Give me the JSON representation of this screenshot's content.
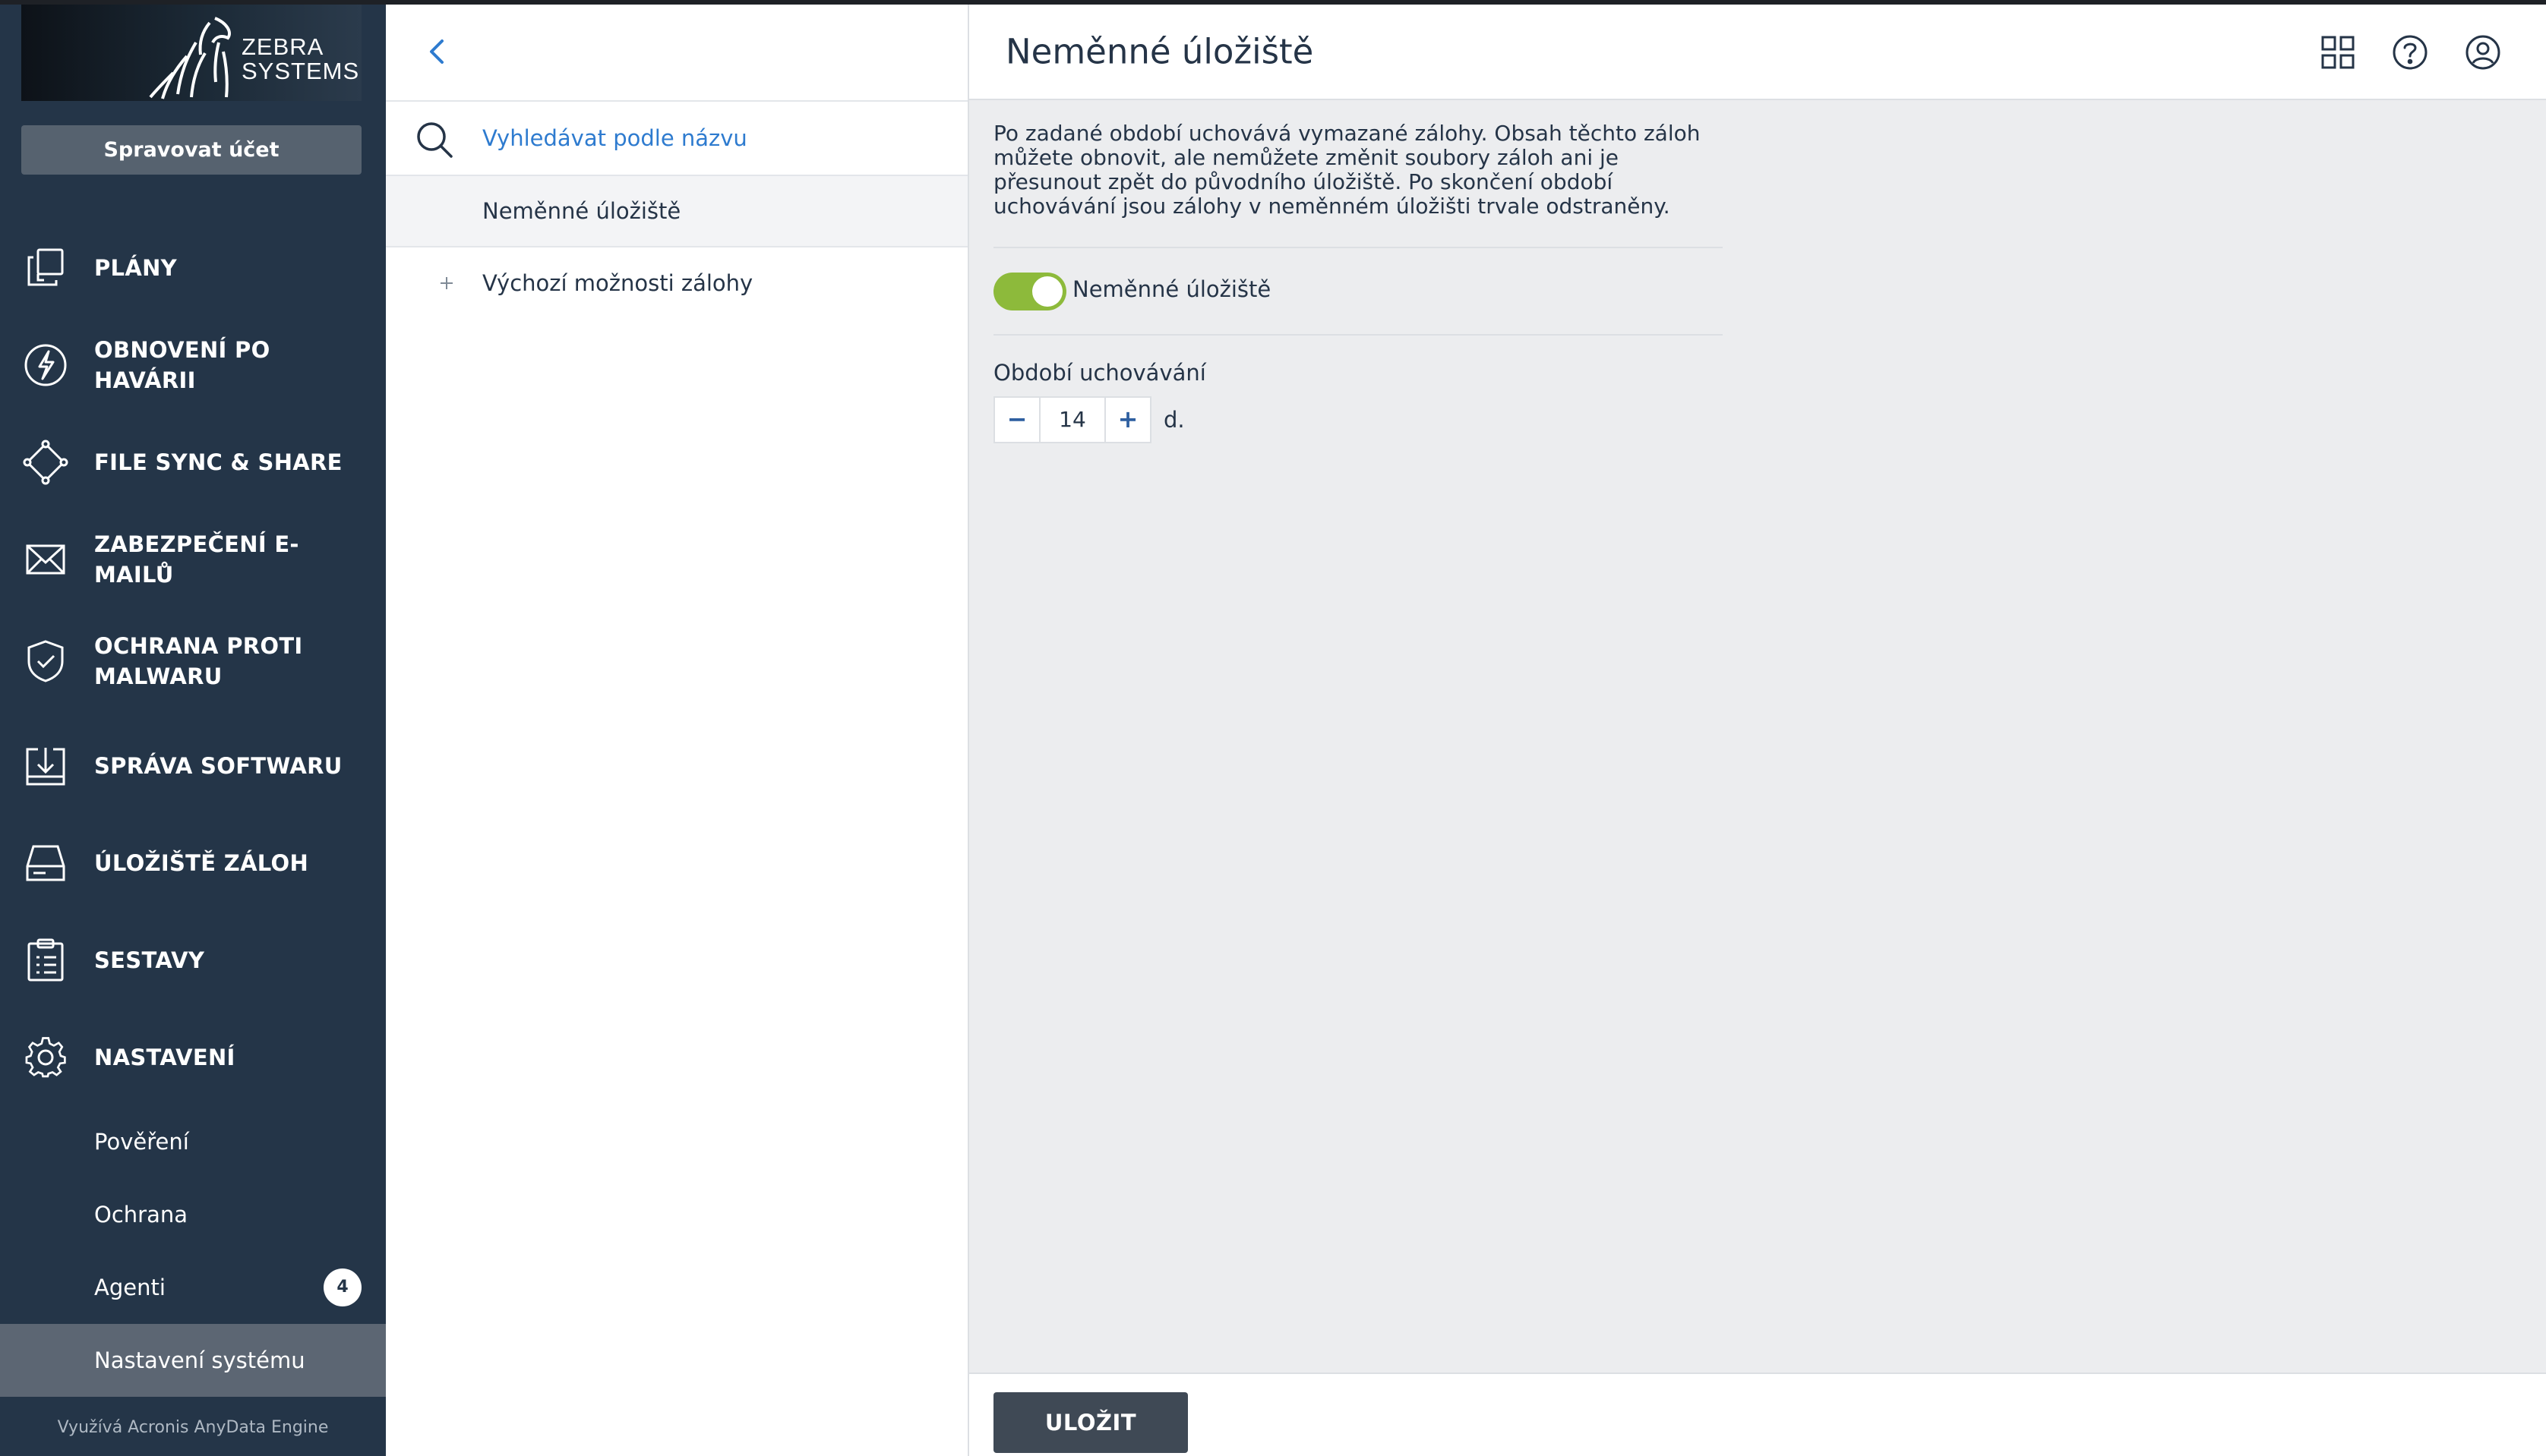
{
  "sidebar": {
    "logo_text_line1": "ZEBRA",
    "logo_text_line2": "SYSTEMS",
    "manage_account": "Spravovat účet",
    "items": [
      {
        "label": "PLÁNY",
        "icon": "plans-icon"
      },
      {
        "label": "OBNOVENÍ PO HAVÁRII",
        "icon": "lightning-icon"
      },
      {
        "label": "FILE SYNC & SHARE",
        "icon": "sync-share-icon"
      },
      {
        "label": "ZABEZPEČENÍ E-MAILŮ",
        "icon": "envelope-icon"
      },
      {
        "label": "OCHRANA PROTI MALWARU",
        "icon": "shield-check-icon"
      },
      {
        "label": "SPRÁVA SOFTWARU",
        "icon": "software-download-icon"
      },
      {
        "label": "ÚLOŽIŠTĚ ZÁLOH",
        "icon": "storage-drive-icon"
      },
      {
        "label": "SESTAVY",
        "icon": "clipboard-report-icon"
      },
      {
        "label": "NASTAVENÍ",
        "icon": "gear-icon"
      }
    ],
    "subitems": [
      {
        "label": "Pověření"
      },
      {
        "label": "Ochrana"
      },
      {
        "label": "Agenti",
        "badge": "4"
      },
      {
        "label": "Nastavení systému"
      }
    ],
    "footer": "Využívá Acronis AnyData Engine"
  },
  "middle": {
    "search_placeholder": "Vyhledávat podle názvu",
    "items": [
      {
        "label": "Neměnné úložiště"
      },
      {
        "label": "Výchozí možnosti zálohy"
      }
    ]
  },
  "main": {
    "title": "Neměnné úložiště",
    "description": "Po zadané období uchovává vymazané zálohy. Obsah těchto záloh můžete obnovit, ale nemůžete změnit soubory záloh ani je přesunout zpět do původního úložiště. Po skončení období uchovávání jsou zálohy v neměnném úložišti trvale odstraněny.",
    "toggle_label": "Neměnné úložiště",
    "toggle_on": true,
    "retention_label": "Období uchovávání",
    "retention_value": "14",
    "retention_unit": "d.",
    "minus": "−",
    "plus": "+",
    "save": "ULOŽIT"
  },
  "colors": {
    "sidebar_bg": "#243548",
    "accent_link": "#2e7bcf",
    "toggle_on": "#8dba3b",
    "save_bg": "#3f4955"
  }
}
